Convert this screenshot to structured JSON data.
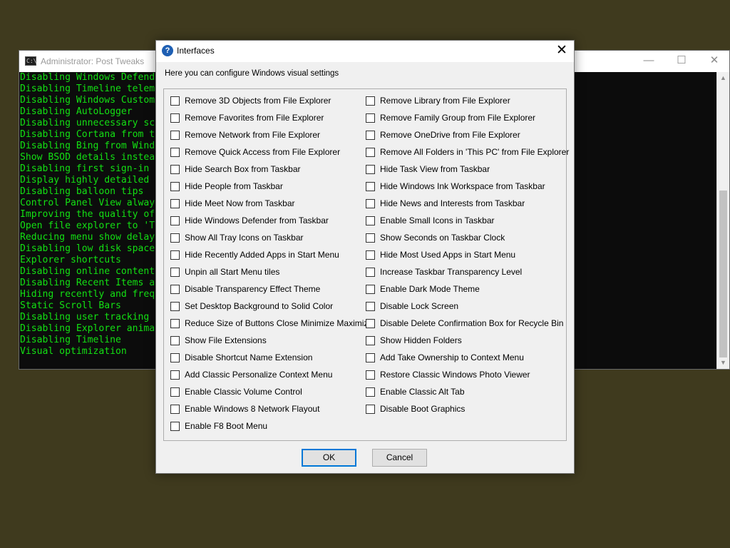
{
  "console": {
    "title": "Administrator:  Post Tweaks",
    "icon_text": "C:\\",
    "controls": {
      "minimize": "—",
      "maximize": "☐",
      "close": "✕"
    },
    "lines": [
      "Disabling Windows Defend",
      "Disabling Timeline telem",
      "Disabling Windows Custom",
      "Disabling AutoLogger",
      "Disabling unnecessary sc",
      "Disabling Cortana from t",
      "Disabling Bing from Wind",
      "Show BSOD details instea",
      "Disabling first sign-in",
      "Display highly detailed",
      "Disabling balloon tips",
      "Control Panel View alway",
      "Improving the quality of",
      "Open file explorer to 'T",
      "Reducing menu show delay",
      "Disabling low disk space",
      "Explorer shortcuts",
      "Disabling online content",
      "Disabling Recent Items a",
      "Hiding recently and freq",
      "Static Scroll Bars",
      "Disabling user tracking",
      "Disabling Explorer anima",
      "Disabling Timeline",
      "Visual optimization"
    ]
  },
  "dialog": {
    "title": "Interfaces",
    "help_icon": "?",
    "close_glyph": "✕",
    "description": "Here you can configure Windows visual settings",
    "left_options": [
      "Remove 3D Objects from File Explorer",
      "Remove Favorites from File Explorer",
      "Remove Network from File Explorer",
      "Remove Quick Access from File Explorer",
      "Hide Search Box from Taskbar",
      "Hide People from Taskbar",
      "Hide Meet Now from Taskbar",
      "Hide Windows Defender from Taskbar",
      "Show All Tray Icons on Taskbar",
      "Hide Recently Added Apps in Start Menu",
      "Unpin all Start Menu tiles",
      "Disable Transparency Effect Theme",
      "Set Desktop Background to Solid Color",
      "Reduce Size of Buttons Close Minimize Maximize",
      "Show File Extensions",
      "Disable Shortcut Name Extension",
      "Add Classic Personalize Context Menu",
      "Enable Classic Volume Control",
      "Enable Windows 8 Network Flayout",
      "Enable F8 Boot Menu"
    ],
    "right_options": [
      "Remove Library from File Explorer",
      "Remove Family Group from File Explorer",
      "Remove OneDrive from File Explorer",
      "Remove All Folders in 'This PC' from File Explorer",
      "Hide Task View from Taskbar",
      "Hide Windows Ink Workspace from Taskbar",
      "Hide News and Interests from Taskbar",
      "Enable Small Icons in Taskbar",
      "Show Seconds on Taskbar Clock",
      "Hide Most Used Apps in Start Menu",
      "Increase Taskbar Transparency Level",
      "Enable Dark Mode Theme",
      "Disable Lock Screen",
      "Disable Delete Confirmation Box for Recycle Bin",
      "Show Hidden Folders",
      "Add Take Ownership to Context Menu",
      "Restore Classic Windows Photo Viewer",
      "Enable Classic Alt Tab",
      "Disable Boot Graphics"
    ],
    "ok_label": "OK",
    "cancel_label": "Cancel"
  },
  "colors": {
    "desktop": "#3f3a1e",
    "console_text": "#13e013",
    "accent": "#0078d7",
    "help_icon": "#1e5fb3"
  }
}
